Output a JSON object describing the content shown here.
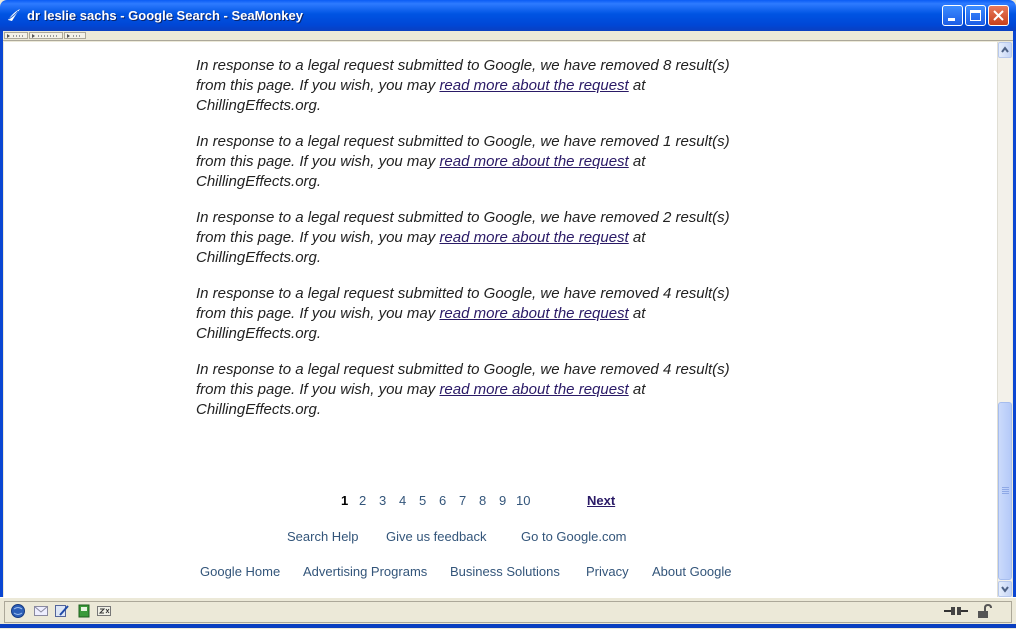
{
  "window": {
    "title": "dr leslie sachs - Google Search - SeaMonkey"
  },
  "notices": [
    {
      "text_before": "In response to a legal request submitted to Google, we have removed 8 result(s) from this page. If you wish, you may ",
      "link": "read more about the request",
      "text_after": " at ChillingEffects.org."
    },
    {
      "text_before": "In response to a legal request submitted to Google, we have removed 1 result(s) from this page. If you wish, you may ",
      "link": "read more about the request",
      "text_after": " at ChillingEffects.org."
    },
    {
      "text_before": "In response to a legal request submitted to Google, we have removed 2 result(s) from this page. If you wish, you may ",
      "link": "read more about the request",
      "text_after": " at ChillingEffects.org."
    },
    {
      "text_before": "In response to a legal request submitted to Google, we have removed 4 result(s) from this page. If you wish, you may ",
      "link": "read more about the request",
      "text_after": " at ChillingEffects.org."
    },
    {
      "text_before": "In response to a legal request submitted to Google, we have removed 4 result(s) from this page. If you wish, you may ",
      "link": "read more about the request",
      "text_after": " at ChillingEffects.org."
    }
  ],
  "pager": {
    "pages": [
      "1",
      "2",
      "3",
      "4",
      "5",
      "6",
      "7",
      "8",
      "9",
      "10"
    ],
    "current": "1",
    "next_label": "Next"
  },
  "footer": {
    "row1": [
      "Search Help",
      "Give us feedback",
      "Go to Google.com"
    ],
    "row2": [
      "Google Home",
      "Advertising Programs",
      "Business Solutions",
      "Privacy",
      "About Google"
    ]
  },
  "colors": {
    "link_visited": "#2a1a66",
    "footer_link": "#33557a",
    "titlebar": "#0054E3"
  },
  "icons": {
    "status": [
      "globe-icon",
      "mail-icon",
      "composer-icon",
      "address-book-icon",
      "irc-chat-icon"
    ],
    "status_right": [
      "offline-connection-icon",
      "security-lock-icon"
    ]
  }
}
